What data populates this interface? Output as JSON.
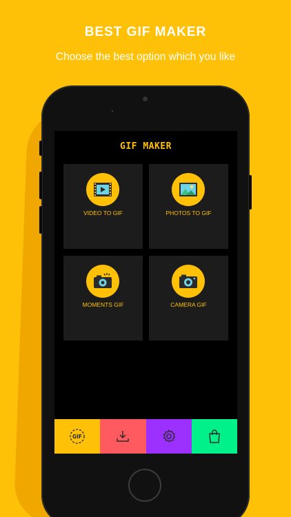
{
  "promo": {
    "headline": "BEST GIF MAKER",
    "subline": "Choose the best option which you like"
  },
  "app": {
    "title": "GIF MAKER",
    "tiles": [
      {
        "label": "VIDEO TO GIF",
        "icon": "film-icon"
      },
      {
        "label": "PHOTOS TO GIF",
        "icon": "photo-icon"
      },
      {
        "label": "MOMENTS GIF",
        "icon": "flash-camera-icon"
      },
      {
        "label": "CAMERA GIF",
        "icon": "camera-icon"
      }
    ],
    "tabs": [
      {
        "icon": "gif-icon",
        "color": "#FFC107"
      },
      {
        "icon": "download-icon",
        "color": "#FF5A5F"
      },
      {
        "icon": "gear-icon",
        "color": "#9B30FF"
      },
      {
        "icon": "shopping-bag-icon",
        "color": "#00F08A"
      }
    ]
  },
  "colors": {
    "background": "#FFC107",
    "accent": "#FFC107",
    "tile": "#1C1C1C"
  }
}
